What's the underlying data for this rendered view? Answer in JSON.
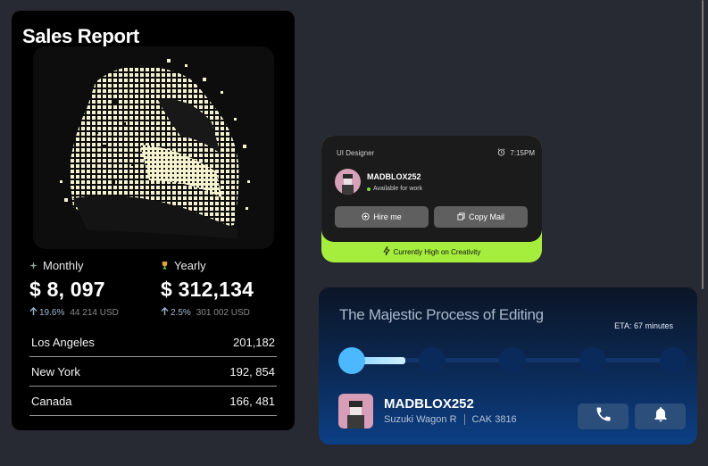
{
  "sales_report": {
    "title": "Sales Report",
    "monthly": {
      "label": "Monthly",
      "value": "$ 8, 097",
      "pct": "19.6%",
      "usd": "44 214 USD"
    },
    "yearly": {
      "label": "Yearly",
      "value": "$ 312,134",
      "pct": "2.5%",
      "usd": "301 002 USD"
    },
    "cities": [
      {
        "name": "Los Angeles",
        "value": "201,182"
      },
      {
        "name": "New York",
        "value": "192, 854"
      },
      {
        "name": "Canada",
        "value": "166, 481"
      }
    ],
    "art_icon": "pixel-car-artwork"
  },
  "designer_card": {
    "role": "UI Designer",
    "time": "7:15PM",
    "name": "MADBLOX252",
    "status": "Available for work",
    "hire_label": "Hire me",
    "copy_label": "Copy Mail",
    "footer": "Currently High on Creativity",
    "accent": "#a6ee3d"
  },
  "editing_card": {
    "title": "The Majestic Process of Editing",
    "eta": "ETA: 67 minutes",
    "name": "MADBLOX252",
    "car": "Suzuki Wagon R",
    "plate": "CAK 3816",
    "steps_total": 5,
    "steps_completed": 1,
    "accent": "#4cb8ff"
  },
  "colors": {
    "background": "#272a33",
    "card": "#000000",
    "positive": "#9fb7d1"
  }
}
